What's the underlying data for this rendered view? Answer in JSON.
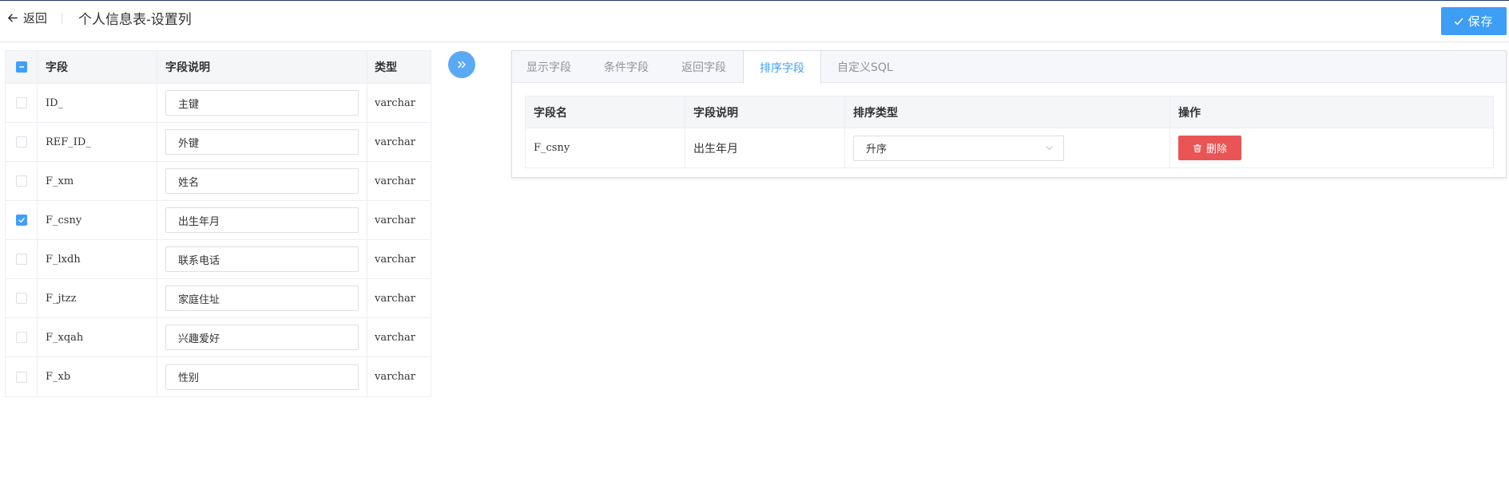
{
  "header": {
    "back_label": "返回",
    "title": "个人信息表-设置列",
    "save_label": "保存"
  },
  "left_table": {
    "columns": {
      "field": "字段",
      "desc": "字段说明",
      "type": "类型"
    },
    "header_checkbox_state": "indeterminate",
    "rows": [
      {
        "field": "ID_",
        "desc": "主键",
        "type": "varchar",
        "checked": false
      },
      {
        "field": "REF_ID_",
        "desc": "外键",
        "type": "varchar",
        "checked": false
      },
      {
        "field": "F_xm",
        "desc": "姓名",
        "type": "varchar",
        "checked": false
      },
      {
        "field": "F_csny",
        "desc": "出生年月",
        "type": "varchar",
        "checked": true
      },
      {
        "field": "F_lxdh",
        "desc": "联系电话",
        "type": "varchar",
        "checked": false
      },
      {
        "field": "F_jtzz",
        "desc": "家庭住址",
        "type": "varchar",
        "checked": false
      },
      {
        "field": "F_xqah",
        "desc": "兴趣爱好",
        "type": "varchar",
        "checked": false
      },
      {
        "field": "F_xb",
        "desc": "性别",
        "type": "varchar",
        "checked": false
      }
    ]
  },
  "tabs": [
    {
      "label": "显示字段",
      "active": false
    },
    {
      "label": "条件字段",
      "active": false
    },
    {
      "label": "返回字段",
      "active": false
    },
    {
      "label": "排序字段",
      "active": true
    },
    {
      "label": "自定义SQL",
      "active": false
    }
  ],
  "sort_table": {
    "columns": {
      "name": "字段名",
      "desc": "字段说明",
      "sort_type": "排序类型",
      "action": "操作"
    },
    "rows": [
      {
        "name": "F_csny",
        "desc": "出生年月",
        "sort_type": "升序",
        "delete_label": "删除"
      }
    ]
  },
  "colors": {
    "primary": "#409eff",
    "save_button": "#3e9df4",
    "danger": "#ea5455",
    "header_bg": "#f5f6f8"
  },
  "icons": {
    "back": "arrow-left-icon",
    "save": "check-icon",
    "transfer": "double-chevron-right-icon",
    "select": "chevron-down-icon",
    "delete": "trash-icon"
  }
}
